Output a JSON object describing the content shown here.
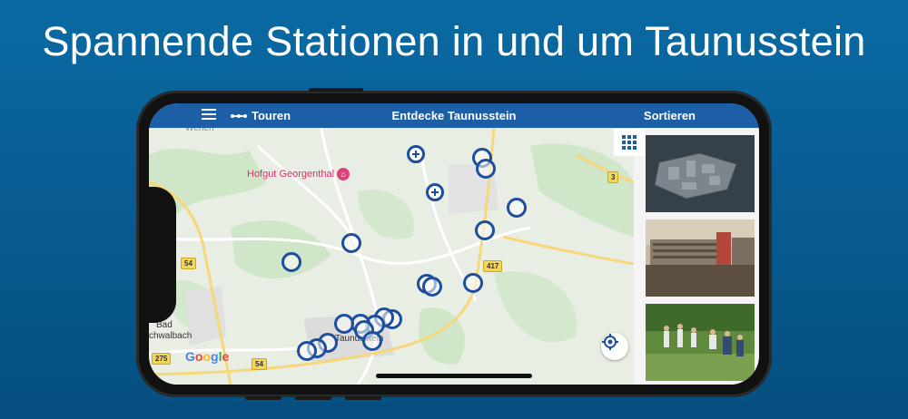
{
  "headline": "Spannende Stationen in und um Taunusstein",
  "app": {
    "menu_icon": "hamburger-icon",
    "tours_label": "Touren",
    "tours_icon": "route-dots-icon",
    "title": "Entdecke Taunusstein",
    "sort_label": "Sortieren",
    "accent_color": "#1c5fa6",
    "marker_color": "#1d4f9e"
  },
  "map": {
    "poi": "Hofgut Georgenthal",
    "poi_icon": "bed-icon",
    "town_label": "Taunusstein",
    "bad_label_1": "Bad",
    "bad_label_2": "chwalbach",
    "top_label": "Wehen",
    "road_3": "3",
    "road_54_left": "54",
    "road_417": "417",
    "road_275": "275",
    "road_54_bottom": "54",
    "attribution": [
      "G",
      "o",
      "o",
      "g",
      "l",
      "e"
    ],
    "locate_icon": "locate-icon",
    "grid_icon": "grid-view-icon"
  },
  "thumbnails": [
    {
      "name": "3d-floorplan-thumbnail"
    },
    {
      "name": "building-photo-thumbnail"
    },
    {
      "name": "group-outdoor-photo-thumbnail"
    }
  ]
}
